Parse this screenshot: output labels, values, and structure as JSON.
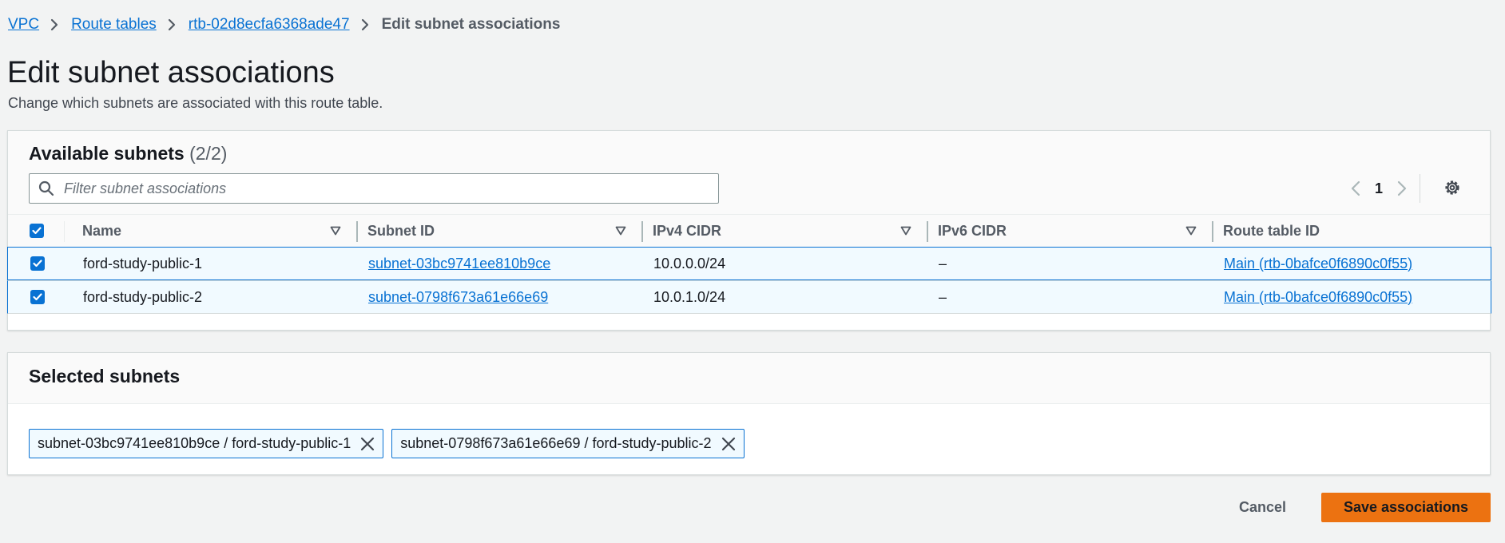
{
  "breadcrumb": {
    "items": [
      {
        "label": "VPC"
      },
      {
        "label": "Route tables"
      },
      {
        "label": "rtb-02d8ecfa6368ade47"
      }
    ],
    "current": "Edit subnet associations"
  },
  "page": {
    "title": "Edit subnet associations",
    "description": "Change which subnets are associated with this route table."
  },
  "available": {
    "title": "Available subnets",
    "count": "(2/2)",
    "search_placeholder": "Filter subnet associations",
    "page_number": "1",
    "columns": [
      "Name",
      "Subnet ID",
      "IPv4 CIDR",
      "IPv6 CIDR",
      "Route table ID"
    ],
    "rows": [
      {
        "name": "ford-study-public-1",
        "subnet_id": "subnet-03bc9741ee810b9ce",
        "ipv4": "10.0.0.0/24",
        "ipv6": "–",
        "route_table": "Main (rtb-0bafce0f6890c0f55)",
        "selected": true
      },
      {
        "name": "ford-study-public-2",
        "subnet_id": "subnet-0798f673a61e66e69",
        "ipv4": "10.0.1.0/24",
        "ipv6": "–",
        "route_table": "Main (rtb-0bafce0f6890c0f55)",
        "selected": true
      }
    ]
  },
  "selected": {
    "title": "Selected subnets",
    "tokens": [
      {
        "label": "subnet-03bc9741ee810b9ce / ford-study-public-1"
      },
      {
        "label": "subnet-0798f673a61e66e69 / ford-study-public-2"
      }
    ]
  },
  "actions": {
    "cancel": "Cancel",
    "save": "Save associations"
  },
  "colors": {
    "link": "#0972d3",
    "primary_button": "#ec7211",
    "selected_row_bg": "#f1faff",
    "page_bg": "#f2f3f3"
  },
  "icons": [
    "chevron-right-icon",
    "search-icon",
    "chevron-left-icon",
    "gear-icon",
    "sort-down-icon",
    "checkmark-icon",
    "close-icon"
  ]
}
